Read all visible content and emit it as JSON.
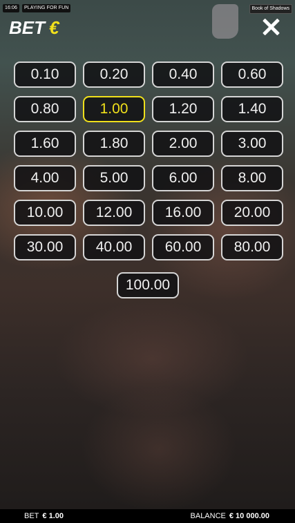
{
  "status": {
    "time": "16:06",
    "mode": "PLAYING FOR FUN",
    "game": "Book of Shadows"
  },
  "header": {
    "title": "BET",
    "currency": "€"
  },
  "bets": {
    "values": [
      "0.10",
      "0.20",
      "0.40",
      "0.60",
      "0.80",
      "1.00",
      "1.20",
      "1.40",
      "1.60",
      "1.80",
      "2.00",
      "3.00",
      "4.00",
      "5.00",
      "6.00",
      "8.00",
      "10.00",
      "12.00",
      "16.00",
      "20.00",
      "30.00",
      "40.00",
      "60.00",
      "80.00",
      "100.00"
    ],
    "selected": "1.00"
  },
  "footer": {
    "bet_label": "BET",
    "bet_value": "€ 1.00",
    "balance_label": "BALANCE",
    "balance_value": "€ 10 000.00"
  },
  "colors": {
    "accent": "#f0e01b",
    "button_bg": "#121214",
    "border": "#ebebeb"
  }
}
